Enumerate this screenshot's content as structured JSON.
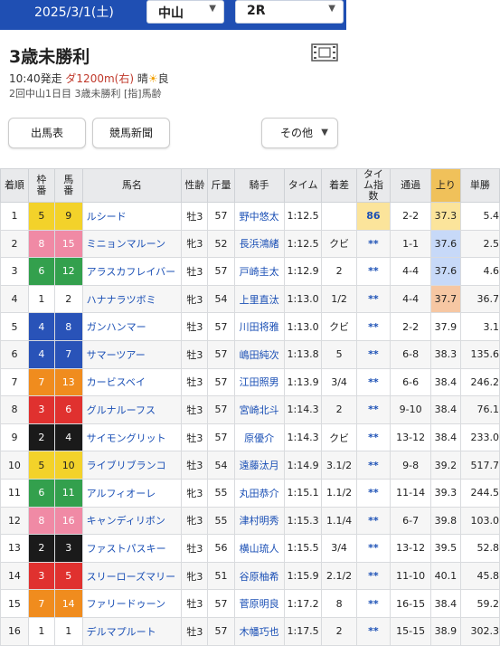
{
  "header": {
    "date": "2025/3/1(土)",
    "venue": "中山",
    "race_no": "2R",
    "caret": "▼"
  },
  "race": {
    "title": "3歳未勝利",
    "start": "10:40発走",
    "course": "ダ1200m(右)",
    "weather": "晴",
    "weather_icon": "☀",
    "going": "良",
    "detail": "2回中山1日目 3歳未勝利 [指]馬齢"
  },
  "buttons": {
    "entries": "出馬表",
    "newspaper": "競馬新聞",
    "other": "その他"
  },
  "columns": [
    "着順",
    "枠番",
    "馬番",
    "馬名",
    "性齢",
    "斤量",
    "騎手",
    "タイム",
    "着差",
    "タイム指数",
    "通過",
    "上り",
    "単勝"
  ],
  "colors": {
    "waku": {
      "1": {
        "bg": "#ffffff",
        "fg": "#222222"
      },
      "2": {
        "bg": "#1a1a1a",
        "fg": "#ffffff"
      },
      "3": {
        "bg": "#e0312f",
        "fg": "#ffffff"
      },
      "4": {
        "bg": "#2953b8",
        "fg": "#ffffff"
      },
      "5": {
        "bg": "#f3d22a",
        "fg": "#222222"
      },
      "6": {
        "bg": "#33a04d",
        "fg": "#ffffff"
      },
      "7": {
        "bg": "#f08c1e",
        "fg": "#ffffff"
      },
      "8": {
        "bg": "#f08aa5",
        "fg": "#ffffff"
      }
    },
    "header_bar": "#1f4fb3",
    "agari_header": "#f0c15a"
  },
  "rows": [
    {
      "rank": "1",
      "waku": "5",
      "num": "9",
      "horse": "ルシード",
      "sex_age": "牡3",
      "weight": "57",
      "jockey": "野中悠太",
      "time": "1:12.5",
      "margin": "",
      "index": "86",
      "passing": "2-2",
      "agari": "37.3",
      "odds": "5.4",
      "index_hl": "gold",
      "agari_hl": "gold"
    },
    {
      "rank": "2",
      "waku": "8",
      "num": "15",
      "horse": "ミニョンマルーン",
      "sex_age": "牝3",
      "weight": "52",
      "jockey": "長浜鴻緒",
      "time": "1:12.5",
      "margin": "クビ",
      "index": "**",
      "passing": "1-1",
      "agari": "37.6",
      "odds": "2.5",
      "agari_hl": "blue"
    },
    {
      "rank": "3",
      "waku": "6",
      "num": "12",
      "horse": "アラスカフレイバー",
      "sex_age": "牡3",
      "weight": "57",
      "jockey": "戸崎圭太",
      "time": "1:12.9",
      "margin": "2",
      "index": "**",
      "passing": "4-4",
      "agari": "37.6",
      "odds": "4.6",
      "agari_hl": "blue"
    },
    {
      "rank": "4",
      "waku": "1",
      "num": "2",
      "horse": "ハナナラツボミ",
      "sex_age": "牝3",
      "weight": "54",
      "jockey": "上里直汰",
      "time": "1:13.0",
      "margin": "1/2",
      "index": "**",
      "passing": "4-4",
      "agari": "37.7",
      "odds": "36.7",
      "agari_hl": "peach"
    },
    {
      "rank": "5",
      "waku": "4",
      "num": "8",
      "horse": "ガンハンマー",
      "sex_age": "牡3",
      "weight": "57",
      "jockey": "川田将雅",
      "time": "1:13.0",
      "margin": "クビ",
      "index": "**",
      "passing": "2-2",
      "agari": "37.9",
      "odds": "3.1"
    },
    {
      "rank": "6",
      "waku": "4",
      "num": "7",
      "horse": "サマーツアー",
      "sex_age": "牡3",
      "weight": "57",
      "jockey": "嶋田純次",
      "time": "1:13.8",
      "margin": "5",
      "index": "**",
      "passing": "6-8",
      "agari": "38.3",
      "odds": "135.6"
    },
    {
      "rank": "7",
      "waku": "7",
      "num": "13",
      "horse": "カービスベイ",
      "sex_age": "牡3",
      "weight": "57",
      "jockey": "江田照男",
      "time": "1:13.9",
      "margin": "3/4",
      "index": "**",
      "passing": "6-6",
      "agari": "38.4",
      "odds": "246.2"
    },
    {
      "rank": "8",
      "waku": "3",
      "num": "6",
      "horse": "グルナルーフス",
      "sex_age": "牡3",
      "weight": "57",
      "jockey": "宮崎北斗",
      "time": "1:14.3",
      "margin": "2",
      "index": "**",
      "passing": "9-10",
      "agari": "38.4",
      "odds": "76.1"
    },
    {
      "rank": "9",
      "waku": "2",
      "num": "4",
      "horse": "サイモングリット",
      "sex_age": "牡3",
      "weight": "57",
      "jockey": "原優介",
      "time": "1:14.3",
      "margin": "クビ",
      "index": "**",
      "passing": "13-12",
      "agari": "38.4",
      "odds": "233.0"
    },
    {
      "rank": "10",
      "waku": "5",
      "num": "10",
      "horse": "ライブリブランコ",
      "sex_age": "牡3",
      "weight": "54",
      "jockey": "遠藤汰月",
      "time": "1:14.9",
      "margin": "3.1/2",
      "index": "**",
      "passing": "9-8",
      "agari": "39.2",
      "odds": "517.7"
    },
    {
      "rank": "11",
      "waku": "6",
      "num": "11",
      "horse": "アルフィオーレ",
      "sex_age": "牝3",
      "weight": "55",
      "jockey": "丸田恭介",
      "time": "1:15.1",
      "margin": "1.1/2",
      "index": "**",
      "passing": "11-14",
      "agari": "39.3",
      "odds": "244.5"
    },
    {
      "rank": "12",
      "waku": "8",
      "num": "16",
      "horse": "キャンディリボン",
      "sex_age": "牝3",
      "weight": "55",
      "jockey": "津村明秀",
      "time": "1:15.3",
      "margin": "1.1/4",
      "index": "**",
      "passing": "6-7",
      "agari": "39.8",
      "odds": "103.0"
    },
    {
      "rank": "13",
      "waku": "2",
      "num": "3",
      "horse": "ファストパスキー",
      "sex_age": "牡3",
      "weight": "56",
      "jockey": "横山琉人",
      "time": "1:15.5",
      "margin": "3/4",
      "index": "**",
      "passing": "13-12",
      "agari": "39.5",
      "odds": "52.8"
    },
    {
      "rank": "14",
      "waku": "3",
      "num": "5",
      "horse": "スリーローズマリー",
      "sex_age": "牝3",
      "weight": "51",
      "jockey": "谷原柚希",
      "time": "1:15.9",
      "margin": "2.1/2",
      "index": "**",
      "passing": "11-10",
      "agari": "40.1",
      "odds": "45.8"
    },
    {
      "rank": "15",
      "waku": "7",
      "num": "14",
      "horse": "ファリードゥーン",
      "sex_age": "牡3",
      "weight": "57",
      "jockey": "菅原明良",
      "time": "1:17.2",
      "margin": "8",
      "index": "**",
      "passing": "16-15",
      "agari": "38.4",
      "odds": "59.2"
    },
    {
      "rank": "16",
      "waku": "1",
      "num": "1",
      "horse": "デルマプルート",
      "sex_age": "牡3",
      "weight": "57",
      "jockey": "木幡巧也",
      "time": "1:17.5",
      "margin": "2",
      "index": "**",
      "passing": "15-15",
      "agari": "38.9",
      "odds": "302.3"
    }
  ]
}
